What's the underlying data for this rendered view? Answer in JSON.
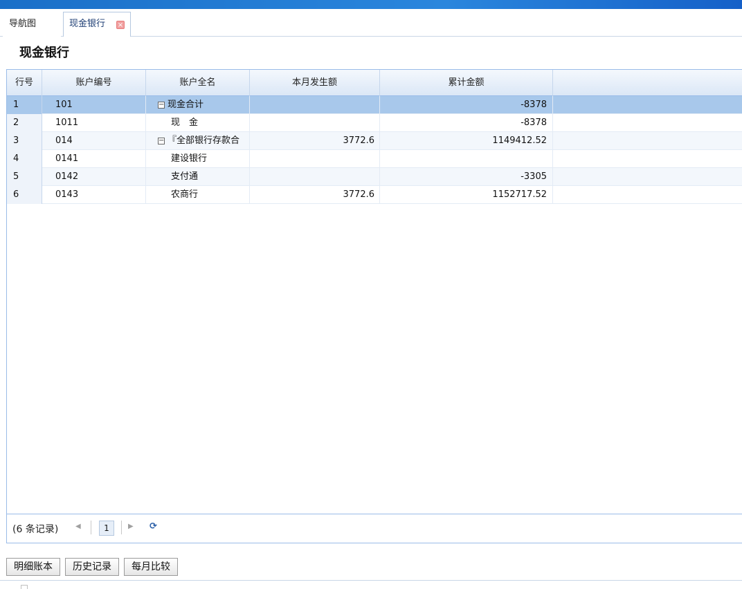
{
  "tabs": [
    {
      "label": "导航图"
    },
    {
      "label": "现金银行",
      "close_glyph": "×"
    }
  ],
  "page": {
    "title": "现金银行"
  },
  "table": {
    "columns": [
      "行号",
      "账户编号",
      "账户全名",
      "本月发生额",
      "累计金额"
    ],
    "rows": [
      {
        "num": "1",
        "code": "101",
        "name": "现金合计",
        "month": "",
        "total": "-8378"
      },
      {
        "num": "2",
        "code": "1011",
        "name": "现　金",
        "month": "",
        "total": "-8378"
      },
      {
        "num": "3",
        "code": "014",
        "name": "『全部银行存款合",
        "month": "3772.6",
        "total": "1149412.52"
      },
      {
        "num": "4",
        "code": "0141",
        "name": "建设银行",
        "month": "",
        "total": ""
      },
      {
        "num": "5",
        "code": "0142",
        "name": "支付通",
        "month": "",
        "total": "-3305"
      },
      {
        "num": "6",
        "code": "0143",
        "name": "农商行",
        "month": "3772.6",
        "total": "1152717.52"
      }
    ]
  },
  "pager": {
    "records": "(6 条记录)",
    "current_page": "1",
    "prev_glyph": "◀",
    "next_glyph": "▶",
    "refresh_glyph": "⟳"
  },
  "actions": {
    "detail": "明细账本",
    "history": "历史记录",
    "monthly": "每月比较"
  }
}
